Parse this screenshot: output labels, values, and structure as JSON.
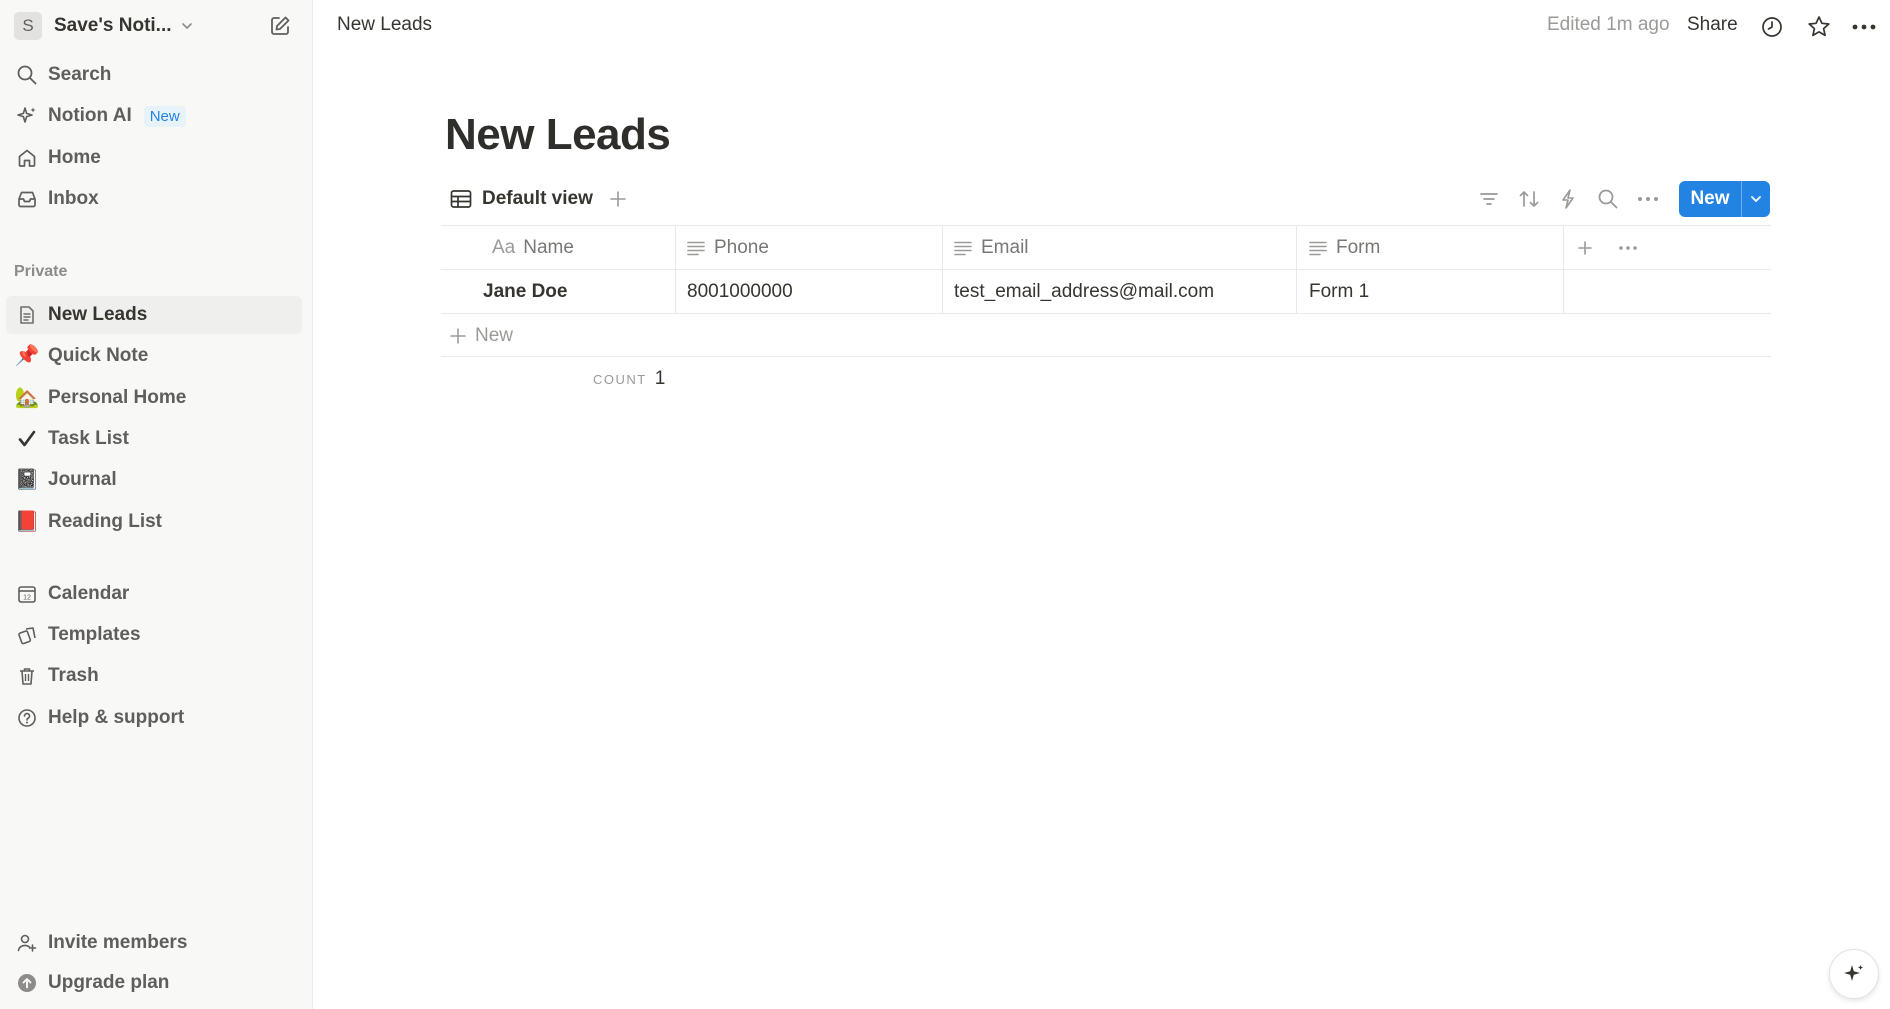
{
  "workspace": {
    "initial": "S",
    "name": "Save's Noti..."
  },
  "sidebar": {
    "top_items": [
      {
        "label": "Search",
        "icon": "search-icon"
      },
      {
        "label": "Notion AI",
        "badge": "New",
        "icon": "sparkle-icon"
      },
      {
        "label": "Home",
        "icon": "home-icon"
      },
      {
        "label": "Inbox",
        "icon": "inbox-icon"
      }
    ],
    "private_label": "Private",
    "private_items": [
      {
        "label": "New Leads",
        "icon": "page-icon",
        "active": true
      },
      {
        "label": "Quick Note",
        "icon": "pushpin-icon",
        "glyph": "📌"
      },
      {
        "label": "Personal Home",
        "icon": "house-emoji-icon",
        "glyph": "🏡"
      },
      {
        "label": "Task List",
        "icon": "checkmark-icon",
        "glyph": "✔"
      },
      {
        "label": "Journal",
        "icon": "journal-icon",
        "glyph": "📓"
      },
      {
        "label": "Reading List",
        "icon": "book-icon",
        "glyph": "📕"
      }
    ],
    "bottom_items": [
      {
        "label": "Calendar",
        "icon": "calendar-icon"
      },
      {
        "label": "Templates",
        "icon": "templates-icon"
      },
      {
        "label": "Trash",
        "icon": "trash-icon"
      },
      {
        "label": "Help & support",
        "icon": "help-icon"
      }
    ],
    "footer_items": [
      {
        "label": "Invite members",
        "icon": "invite-icon"
      },
      {
        "label": "Upgrade plan",
        "icon": "upgrade-icon"
      }
    ]
  },
  "topbar": {
    "breadcrumb": "New Leads",
    "edited": "Edited 1m ago",
    "share": "Share"
  },
  "page": {
    "title": "New Leads",
    "view_tab": "Default view",
    "new_button": "New"
  },
  "table": {
    "columns": [
      {
        "label": "Name",
        "prefix": "Aa"
      },
      {
        "label": "Phone"
      },
      {
        "label": "Email"
      },
      {
        "label": "Form"
      }
    ],
    "rows": [
      {
        "name": "Jane Doe",
        "phone": "8001000000",
        "email": "test_email_address@mail.com",
        "form": "Form 1"
      }
    ],
    "new_row_label": "New",
    "count_label": "COUNT",
    "count_value": "1"
  },
  "colors": {
    "accent": "#2383e2",
    "sidebar_bg": "#f8f8f7",
    "text": "#37352f",
    "muted": "#9b9a97"
  }
}
